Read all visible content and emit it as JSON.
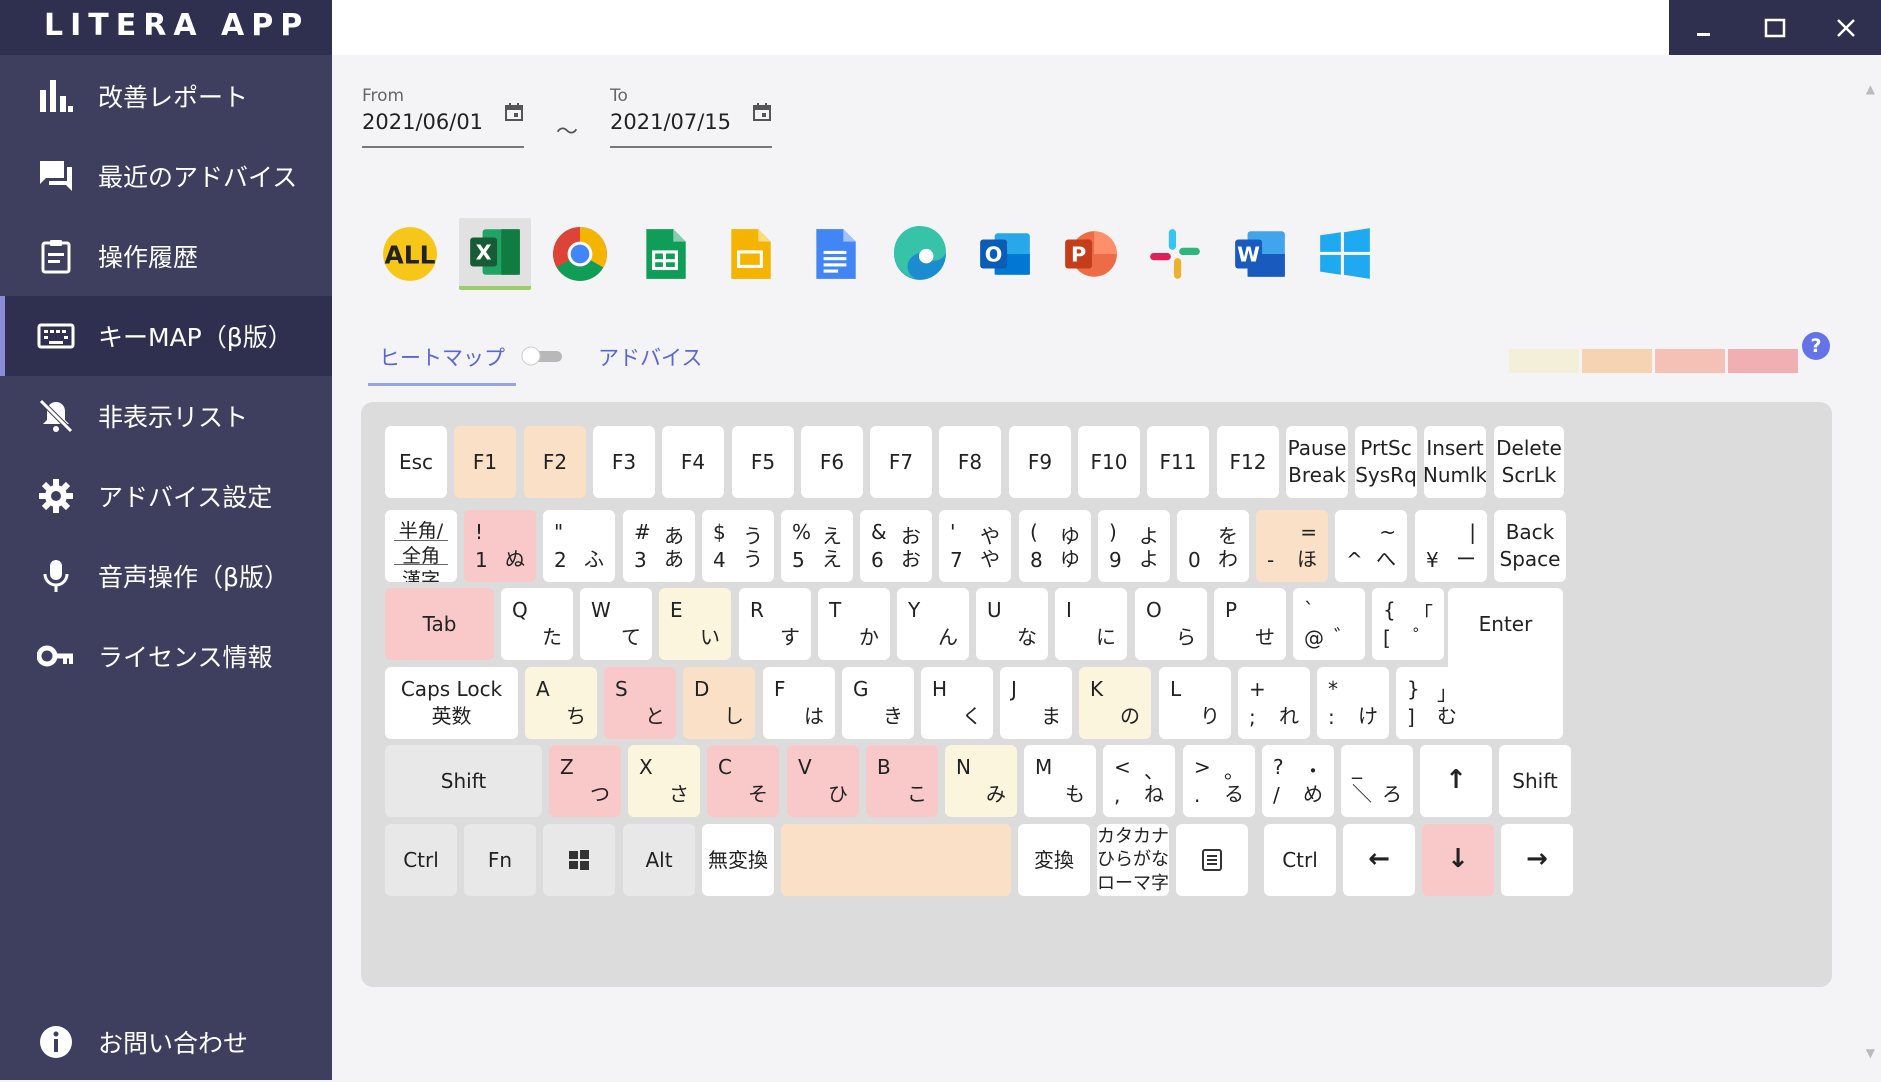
{
  "app": {
    "title": "LITERA APP"
  },
  "sidebar": {
    "items": [
      {
        "label": "改善レポート",
        "icon": "bar-chart-icon"
      },
      {
        "label": "最近のアドバイス",
        "icon": "chat-icon"
      },
      {
        "label": "操作履歴",
        "icon": "clipboard-icon"
      },
      {
        "label": "キーMAP（β版）",
        "icon": "keyboard-icon",
        "active": true
      },
      {
        "label": "非表示リスト",
        "icon": "bell-off-icon"
      },
      {
        "label": "アドバイス設定",
        "icon": "gear-icon"
      },
      {
        "label": "音声操作（β版）",
        "icon": "microphone-icon"
      },
      {
        "label": "ライセンス情報",
        "icon": "key-icon"
      }
    ],
    "bottom": {
      "label": "お問い合わせ",
      "icon": "info-icon"
    }
  },
  "dates": {
    "from_label": "From",
    "from_value": "2021/06/01",
    "to_label": "To",
    "to_value": "2021/07/15",
    "separator": "～"
  },
  "apps": [
    {
      "name": "all",
      "label": "ALL"
    },
    {
      "name": "excel",
      "label": "X",
      "selected": true
    },
    {
      "name": "chrome"
    },
    {
      "name": "google-sheets"
    },
    {
      "name": "google-slides"
    },
    {
      "name": "google-docs"
    },
    {
      "name": "edge"
    },
    {
      "name": "outlook",
      "label": "O"
    },
    {
      "name": "powerpoint",
      "label": "P"
    },
    {
      "name": "slack"
    },
    {
      "name": "word",
      "label": "W"
    },
    {
      "name": "windows"
    }
  ],
  "tabs": {
    "heatmap": "ヒートマップ",
    "advice": "アドバイス"
  },
  "toggle": {
    "on": false
  },
  "legend": {
    "colors": [
      "#f3efd9",
      "#f6d3b2",
      "#f5c0b6",
      "#f1aeb3"
    ]
  },
  "help": "?",
  "heat_colors": {
    "y": "#faf5dc",
    "o": "#fbe0c8",
    "r": "#f9c8c8",
    "w": "#ffffff",
    "g": "#e8e8e8"
  },
  "keyboard": {
    "row0": [
      {
        "main": "Esc"
      },
      {
        "main": "F1",
        "heat": "o"
      },
      {
        "main": "F2",
        "heat": "o"
      },
      {
        "main": "F3"
      },
      {
        "main": "F4"
      },
      {
        "main": "F5"
      },
      {
        "main": "F6"
      },
      {
        "main": "F7"
      },
      {
        "main": "F8"
      },
      {
        "main": "F9"
      },
      {
        "main": "F10"
      },
      {
        "main": "F11"
      },
      {
        "main": "F12"
      },
      {
        "main": "Pause\nBreak"
      },
      {
        "main": "PrtSc\nSysRq"
      },
      {
        "main": "Insert\nNumlk"
      },
      {
        "main": "Delete\nScrLk"
      }
    ],
    "row1": [
      {
        "hankaku": [
          "半角/",
          "全角",
          "漢字"
        ]
      },
      {
        "tl": "!",
        "bl": "1",
        "br": "ぬ",
        "heat": "r"
      },
      {
        "tl": "\"",
        "bl": "2",
        "br": "ふ"
      },
      {
        "tl": "#",
        "tr": "あ",
        "bl": "3",
        "br": "あ"
      },
      {
        "tl": "$",
        "tr": "う",
        "bl": "4",
        "br": "う"
      },
      {
        "tl": "%",
        "tr": "え",
        "bl": "5",
        "br": "え"
      },
      {
        "tl": "&",
        "tr": "お",
        "bl": "6",
        "br": "お"
      },
      {
        "tl": "'",
        "tr": "や",
        "bl": "7",
        "br": "や"
      },
      {
        "tl": "(",
        "tr": "ゆ",
        "bl": "8",
        "br": "ゆ"
      },
      {
        "tl": ")",
        "tr": "よ",
        "bl": "9",
        "br": "よ"
      },
      {
        "tr": "を",
        "bl": "0",
        "br": "わ"
      },
      {
        "tr": "=",
        "bl": "-",
        "br": "ほ",
        "heat": "o"
      },
      {
        "tr": "~",
        "bl": "^",
        "br": "へ"
      },
      {
        "tr": "|",
        "bl": "¥",
        "br": "ー"
      },
      {
        "main": "Back\nSpace"
      }
    ],
    "row2": [
      {
        "main": "Tab",
        "heat": "r"
      },
      {
        "tl": "Q",
        "br": "た"
      },
      {
        "tl": "W",
        "br": "て"
      },
      {
        "tl": "E",
        "br": "い",
        "heat": "y"
      },
      {
        "tl": "R",
        "br": "す"
      },
      {
        "tl": "T",
        "br": "か"
      },
      {
        "tl": "Y",
        "br": "ん"
      },
      {
        "tl": "U",
        "br": "な"
      },
      {
        "tl": "I",
        "br": "に"
      },
      {
        "tl": "O",
        "br": "ら"
      },
      {
        "tl": "P",
        "br": "せ"
      },
      {
        "tl": "`",
        "bl": "@",
        "br": "゛"
      },
      {
        "tl": "{",
        "tr": "「",
        "bl": "[",
        "br": "゜"
      }
    ],
    "enter": "Enter",
    "row3": [
      {
        "main": "Caps Lock\n英数"
      },
      {
        "tl": "A",
        "br": "ち",
        "heat": "y"
      },
      {
        "tl": "S",
        "br": "と",
        "heat": "r"
      },
      {
        "tl": "D",
        "br": "し",
        "heat": "o"
      },
      {
        "tl": "F",
        "br": "は"
      },
      {
        "tl": "G",
        "br": "き"
      },
      {
        "tl": "H",
        "br": "く"
      },
      {
        "tl": "J",
        "br": "ま"
      },
      {
        "tl": "K",
        "br": "の",
        "heat": "y"
      },
      {
        "tl": "L",
        "br": "り"
      },
      {
        "tl": "+",
        "bl": ";",
        "br": "れ"
      },
      {
        "tl": "*",
        "bl": ":",
        "br": "け"
      },
      {
        "tl": "}",
        "tr": "」",
        "bl": "]",
        "br": "む"
      }
    ],
    "row4": [
      {
        "main": "Shift",
        "heat": "g"
      },
      {
        "tl": "Z",
        "br": "つ",
        "heat": "r"
      },
      {
        "tl": "X",
        "br": "さ",
        "heat": "y"
      },
      {
        "tl": "C",
        "br": "そ",
        "heat": "r"
      },
      {
        "tl": "V",
        "br": "ひ",
        "heat": "r"
      },
      {
        "tl": "B",
        "br": "こ",
        "heat": "r"
      },
      {
        "tl": "N",
        "br": "み",
        "heat": "y"
      },
      {
        "tl": "M",
        "br": "も"
      },
      {
        "tl": "<",
        "tr": "、",
        "bl": ",",
        "br": "ね"
      },
      {
        "tl": ">",
        "tr": "。",
        "bl": ".",
        "br": "る"
      },
      {
        "tl": "?",
        "tr": "・",
        "bl": "/",
        "br": "め"
      },
      {
        "tl": "_",
        "bl": "＼",
        "br": "ろ"
      },
      {
        "main": "↑"
      },
      {
        "main": "Shift"
      }
    ],
    "row5": [
      {
        "main": "Ctrl",
        "heat": "g"
      },
      {
        "main": "Fn",
        "heat": "g"
      },
      {
        "icon": "windows-key-icon",
        "heat": "g"
      },
      {
        "main": "Alt",
        "heat": "g"
      },
      {
        "main": "無変換"
      },
      {
        "main": "",
        "heat": "o",
        "name": "space"
      },
      {
        "main": "変換"
      },
      {
        "main": "カタカナ\nひらがな\nローマ字"
      },
      {
        "icon": "menu-key-icon"
      },
      {
        "main": "Ctrl"
      },
      {
        "main": "←"
      },
      {
        "main": "↓",
        "heat": "r"
      },
      {
        "main": "→"
      }
    ]
  }
}
